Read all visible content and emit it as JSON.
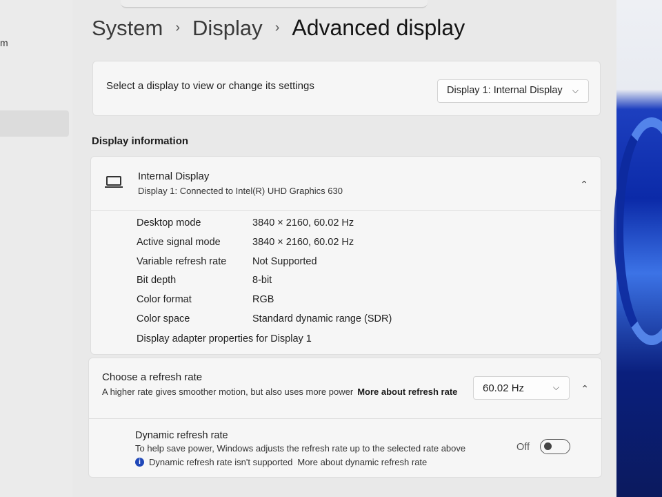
{
  "sidebar": {
    "partial_text": "m"
  },
  "breadcrumb": {
    "items": [
      "System",
      "Display",
      "Advanced display"
    ]
  },
  "select_display": {
    "label": "Select a display to view or change its settings",
    "dropdown_value": "Display 1: Internal Display"
  },
  "display_information": {
    "heading": "Display information",
    "name": "Internal Display",
    "subtitle": "Display 1: Connected to Intel(R) UHD Graphics 630",
    "rows": [
      {
        "label": "Desktop mode",
        "value": "3840 × 2160, 60.02 Hz"
      },
      {
        "label": "Active signal mode",
        "value": "3840 × 2160, 60.02 Hz"
      },
      {
        "label": "Variable refresh rate",
        "value": "Not Supported"
      },
      {
        "label": "Bit depth",
        "value": "8-bit"
      },
      {
        "label": "Color format",
        "value": "RGB"
      },
      {
        "label": "Color space",
        "value": "Standard dynamic range (SDR)"
      }
    ],
    "adapter_link": "Display adapter properties for Display 1"
  },
  "refresh_rate": {
    "title": "Choose a refresh rate",
    "description": "A higher rate gives smoother motion, but also uses more power",
    "link": "More about refresh rate",
    "dropdown_value": "60.02 Hz",
    "dynamic": {
      "title": "Dynamic refresh rate",
      "description": "To help save power, Windows adjusts the refresh rate up to the selected rate above",
      "note": "Dynamic refresh rate isn't supported",
      "note_link": "More about dynamic refresh rate",
      "toggle_state": "Off"
    }
  },
  "icons": {
    "breadcrumb_separator": "chevron-right-icon",
    "dropdown": "chevron-down-icon",
    "collapse": "chevron-up-icon",
    "display": "monitor-icon",
    "info": "info-icon"
  },
  "colors": {
    "accent": "#1f47b8",
    "card_bg": "#f6f6f6",
    "page_bg": "#e9e9e9"
  }
}
